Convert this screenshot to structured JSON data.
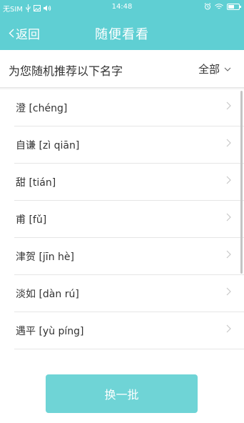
{
  "status_bar": {
    "carrier": "无SIM",
    "time": "14:48",
    "battery_level": 0.6
  },
  "nav": {
    "back_label": "返回",
    "title": "随便看看"
  },
  "header": {
    "text": "为您随机推荐以下名字",
    "filter_label": "全部"
  },
  "names": [
    {
      "label": "澄 [chéng]"
    },
    {
      "label": "自谦 [zì qiān]"
    },
    {
      "label": "甜 [tián]"
    },
    {
      "label": "甫 [fǔ]"
    },
    {
      "label": "津贺 [jīn hè]"
    },
    {
      "label": "淡如 [dàn rú]"
    },
    {
      "label": "遇平 [yù píng]"
    }
  ],
  "refresh_button": {
    "label": "换一批"
  },
  "colors": {
    "accent": "#5fcfd3",
    "button": "#6fd4d6",
    "text": "#333333",
    "chevron": "#c8c8c8"
  }
}
